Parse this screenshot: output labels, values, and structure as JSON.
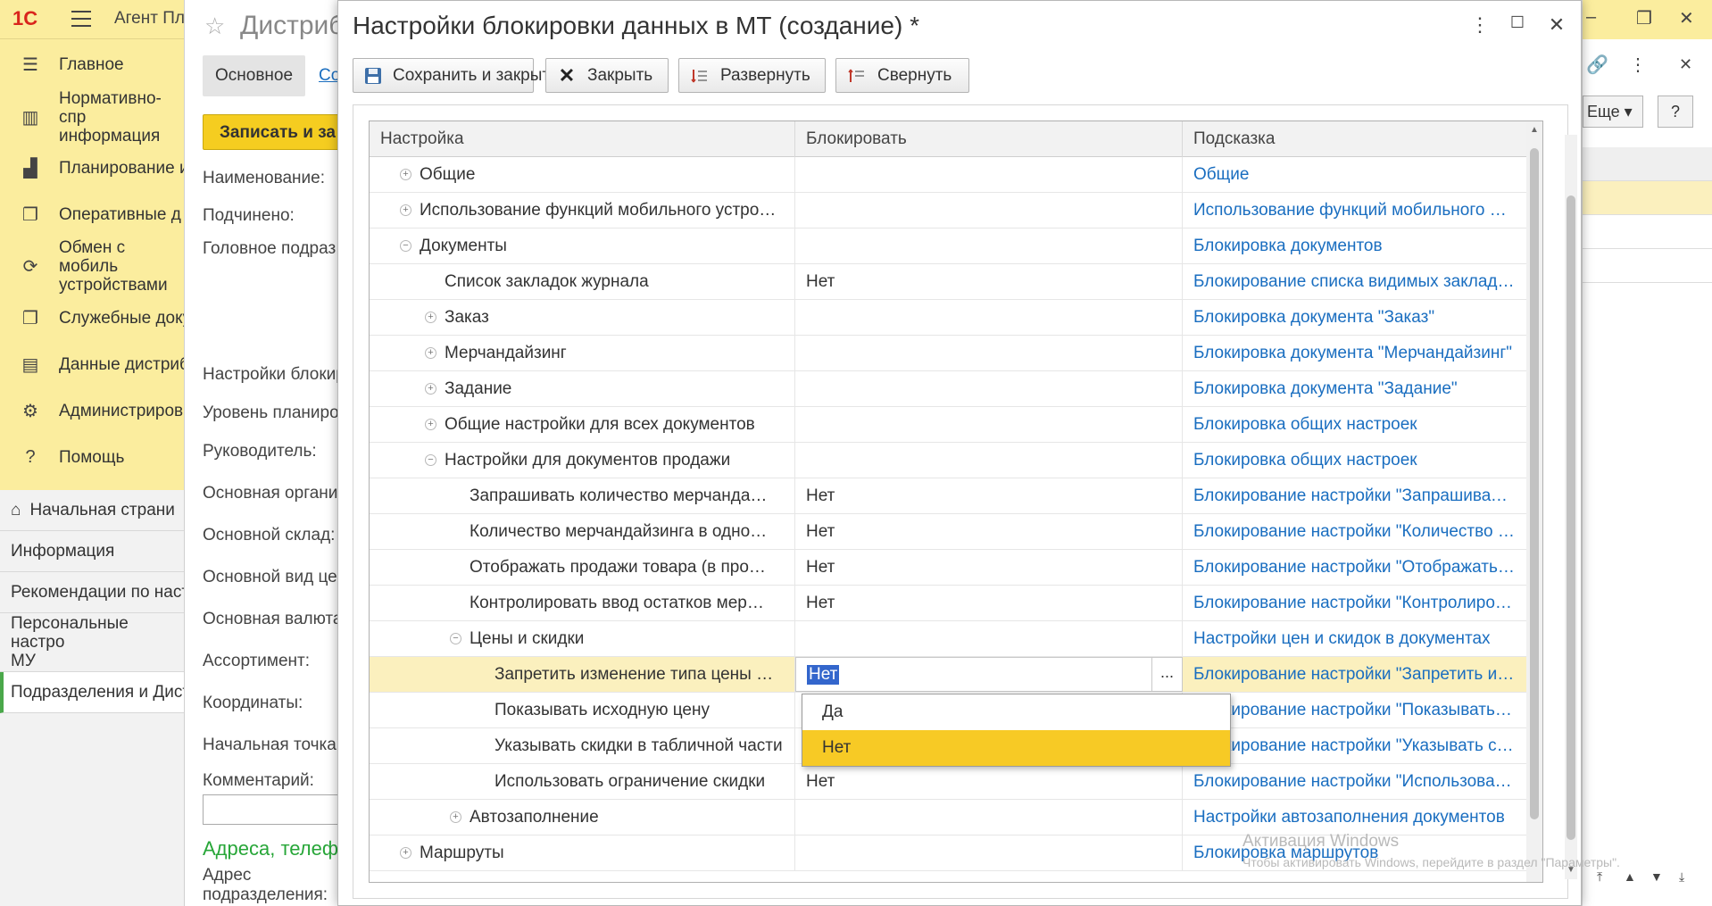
{
  "app": {
    "logo": "1С",
    "title": "Агент Пл"
  },
  "sidebar": {
    "sections": [
      {
        "label": "Главное",
        "icon": "list-icon"
      },
      {
        "label": "Нормативно-спр\nинформация",
        "icon": "bar-chart-icon"
      },
      {
        "label": "Планирование и",
        "icon": "chart-icon"
      },
      {
        "label": "Оперативные д",
        "icon": "documents-icon"
      },
      {
        "label": "Обмен с мобиль\nустройствами",
        "icon": "sync-icon"
      },
      {
        "label": "Служебные доку",
        "icon": "documents-icon"
      },
      {
        "label": "Данные дистриб",
        "icon": "data-icon"
      },
      {
        "label": "Администриров",
        "icon": "gear-icon"
      },
      {
        "label": "Помощь",
        "icon": "help-icon"
      }
    ]
  },
  "bottom_nav": {
    "items": [
      {
        "label": "Начальная страни"
      },
      {
        "label": "Информация"
      },
      {
        "label": "Рекомендации по наст"
      },
      {
        "label": "Персональные настро\nМУ"
      },
      {
        "label": "Подразделения и Дист"
      }
    ]
  },
  "bg_form": {
    "title": "Дистриб",
    "tab_main": "Основное",
    "tab_2": "Со",
    "write_button": "Записать и за",
    "fields": [
      "Наименование:",
      "Подчинено:",
      "Головное подраз",
      "Настройки блокир",
      "Уровень планиро",
      "Руководитель:",
      "Основная органи",
      "Основной склад:",
      "Основной вид цен",
      "Основная валюта",
      "Ассортимент:",
      "Координаты:",
      "Начальная точка",
      "Комментарий:"
    ],
    "section_title": "Адреса, телеф",
    "address_label": "Адрес\nподразделения:"
  },
  "right_bg": {
    "more_label": "Еще",
    "help_label": "?"
  },
  "modal": {
    "title": "Настройки блокировки данных в МТ (создание) *",
    "toolbar": {
      "save_close": "Сохранить и закрыть",
      "close": "Закрыть",
      "expand": "Развернуть",
      "collapse": "Свернуть"
    },
    "grid": {
      "columns": [
        "Настройка",
        "Блокировать",
        "Подсказка"
      ],
      "rows": [
        {
          "name": "Общие",
          "level": 0,
          "expander": "plus",
          "value": "",
          "hint": "Общие"
        },
        {
          "name": "Использование функций мобильного устро…",
          "level": 0,
          "expander": "plus",
          "value": "",
          "hint": "Использование функций мобильного у…"
        },
        {
          "name": "Документы",
          "level": 0,
          "expander": "minus",
          "value": "",
          "hint": "Блокировка документов"
        },
        {
          "name": "Список закладок журнала",
          "level": 1,
          "expander": "",
          "value": "Нет",
          "hint": "Блокирование списка видимых заклад…"
        },
        {
          "name": "Заказ",
          "level": 1,
          "expander": "plus",
          "value": "",
          "hint": "Блокировка документа \"Заказ\""
        },
        {
          "name": "Мерчандайзинг",
          "level": 1,
          "expander": "plus",
          "value": "",
          "hint": "Блокировка документа \"Мерчандайзинг\""
        },
        {
          "name": "Задание",
          "level": 1,
          "expander": "plus",
          "value": "",
          "hint": "Блокировка документа \"Задание\""
        },
        {
          "name": "Общие настройки для всех документов",
          "level": 1,
          "expander": "plus",
          "value": "",
          "hint": "Блокировка общих настроек"
        },
        {
          "name": "Настройки для документов продажи",
          "level": 1,
          "expander": "minus",
          "value": "",
          "hint": "Блокировка общих настроек"
        },
        {
          "name": "Запрашивать количество мерчанда…",
          "level": 2,
          "expander": "",
          "value": "Нет",
          "hint": "Блокирование настройки \"Запрашиват…"
        },
        {
          "name": "Количество мерчандайзинга в одно…",
          "level": 2,
          "expander": "",
          "value": "Нет",
          "hint": "Блокирование настройки \"Количество …"
        },
        {
          "name": "Отображать продажи товара (в про…",
          "level": 2,
          "expander": "",
          "value": "Нет",
          "hint": "Блокирование настройки \"Отображать …"
        },
        {
          "name": "Контролировать ввод остатков мер…",
          "level": 2,
          "expander": "",
          "value": "Нет",
          "hint": "Блокирование настройки \"Контролиров…"
        },
        {
          "name": "Цены и скидки",
          "level": 2,
          "expander": "minus",
          "value": "",
          "hint": "Настройки цен и скидок в документах"
        },
        {
          "name": "Запретить изменение типа цены …",
          "level": 3,
          "expander": "",
          "value": "Нет",
          "hint": "Блокирование настройки \"Запретить из…",
          "selected": true,
          "editing": true
        },
        {
          "name": "Показывать исходную цену",
          "level": 3,
          "expander": "",
          "value": "",
          "hint": "Блокирование настройки \"Показывать …"
        },
        {
          "name": "Указывать скидки в табличной части",
          "level": 3,
          "expander": "",
          "value": "",
          "hint": "Блокирование настройки \"Указывать с…"
        },
        {
          "name": "Использовать ограничение скидки",
          "level": 3,
          "expander": "",
          "value": "Нет",
          "hint": "Блокирование настройки \"Использова…"
        },
        {
          "name": "Автозаполнение",
          "level": 2,
          "expander": "plus",
          "value": "",
          "hint": "Настройки автозаполнения документов"
        },
        {
          "name": "Маршруты",
          "level": 0,
          "expander": "plus",
          "value": "",
          "hint": "Блокировка маршрутов"
        }
      ]
    },
    "edit_dots": "...",
    "dropdown": {
      "options": [
        {
          "label": "Да",
          "highlighted": false
        },
        {
          "label": "Нет",
          "highlighted": true
        }
      ]
    }
  },
  "watermark": {
    "line1": "Активация Windows",
    "line2": "Чтобы активировать Windows, перейдите в раздел \"Параметры\"."
  },
  "colors": {
    "sidebar_bg": "#fbed9e",
    "accent_yellow": "#f5cd20",
    "link_blue": "#1a6ec0",
    "selection": "#3366cc",
    "selected_row": "#fbf0be",
    "green_active": "#4aa84a"
  }
}
